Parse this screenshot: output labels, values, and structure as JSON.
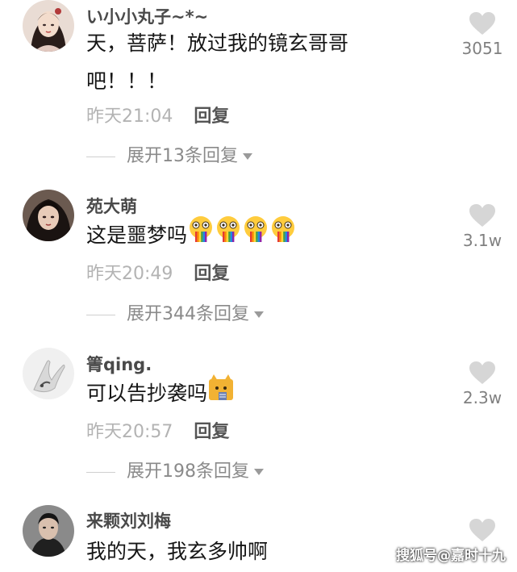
{
  "comments": [
    {
      "username": "い小小丸子~*~",
      "text": "天，菩萨！放过我的镜玄哥哥吧！！！",
      "time": "昨天21:04",
      "reply_label": "回复",
      "expand_label": "展开13条回复",
      "likes": "3051"
    },
    {
      "username": "苑大萌",
      "text": "这是噩梦吗",
      "emoji": "vomit-rainbow-emoji",
      "emoji_count": 4,
      "time": "昨天20:49",
      "reply_label": "回复",
      "expand_label": "展开344条回复",
      "likes": "3.1w"
    },
    {
      "username": "箐qing.",
      "text": "可以告抄袭吗",
      "emoji": "cat-emoji",
      "time": "昨天20:57",
      "reply_label": "回复",
      "expand_label": "展开198条回复",
      "likes": "2.3w"
    },
    {
      "username": "来颗刘刘梅",
      "text": "我的天，我玄多帅啊",
      "likes": ""
    }
  ],
  "watermark": "搜狐号@嘉时十九",
  "icons": {
    "like": "heart-icon",
    "expand": "triangle-down-icon"
  },
  "colors": {
    "username": "#4a4a4a",
    "text": "#161616",
    "time": "#b3b3b3",
    "heart": "#d6d6d6"
  }
}
